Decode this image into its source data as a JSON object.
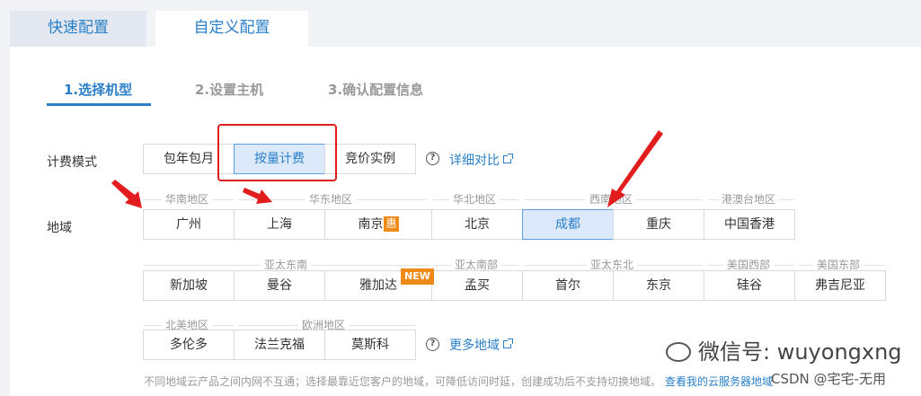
{
  "tabs": {
    "quick": "快速配置",
    "custom": "自定义配置"
  },
  "steps": {
    "s1": "1.选择机型",
    "s2": "2.设置主机",
    "s3": "3.确认配置信息"
  },
  "billing": {
    "label": "计费模式",
    "options": [
      "包年包月",
      "按量计费",
      "竞价实例"
    ],
    "selected": "按量计费",
    "help": "?",
    "detail_link": "详细对比"
  },
  "region": {
    "label": "地域",
    "groups": {
      "south_china": "华南地区",
      "east_china": "华东地区",
      "north_china": "华北地区",
      "southwest": "西南地区",
      "hk_macao_tw": "港澳台地区",
      "asia_se": "亚太东南",
      "asia_south": "亚太南部",
      "asia_ne": "亚太东北",
      "us_west": "美国西部",
      "us_east": "美国东部",
      "north_america": "北美地区",
      "europe": "欧洲地区"
    },
    "cities": {
      "guangzhou": "广州",
      "shanghai": "上海",
      "nanjing": "南京",
      "beijing": "北京",
      "chengdu": "成都",
      "chongqing": "重庆",
      "hongkong": "中国香港",
      "singapore": "新加坡",
      "bangkok": "曼谷",
      "jakarta": "雅加达",
      "mumbai": "孟买",
      "seoul": "首尔",
      "tokyo": "东京",
      "silicon_valley": "硅谷",
      "virginia": "弗吉尼亚",
      "toronto": "多伦多",
      "frankfurt": "法兰克福",
      "moscow": "莫斯科"
    },
    "selected": "成都",
    "badge_hui": "惠",
    "badge_new": "NEW",
    "help": "?",
    "more_link": "更多地域"
  },
  "note": "不同地域云产品之间内网不互通；选择最靠近您客户的地域，可降低访问时延，创建成功后不支持切换地域。",
  "note_link": "查看我的云服务器地域",
  "watermark": {
    "wechat": "微信号: wuyongxng",
    "csdn": "CSDN @宅宅-无用"
  },
  "colors": {
    "accent": "#2a7fc8",
    "selected_bg": "#dce9fa",
    "badge": "#f08a17",
    "annotation": "#e21d1d"
  },
  "icons": [
    "help-circle-icon",
    "external-link-icon",
    "wechat-icon"
  ]
}
